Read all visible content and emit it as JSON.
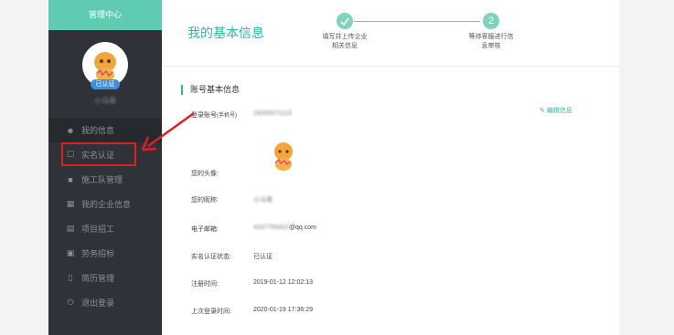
{
  "sidebar": {
    "title": "管理中心",
    "badge": "已认证",
    "username": "小马哥",
    "items": [
      {
        "label": "我的信息",
        "icon": "user-icon"
      },
      {
        "label": "实名认证",
        "icon": "bookmark-icon"
      },
      {
        "label": "施工队管理",
        "icon": "team-icon"
      },
      {
        "label": "我的企业信息",
        "icon": "building-icon"
      },
      {
        "label": "项目招工",
        "icon": "document-icon"
      },
      {
        "label": "劳务招标",
        "icon": "wallet-icon"
      },
      {
        "label": "简历管理",
        "icon": "resume-icon"
      },
      {
        "label": "退出登录",
        "icon": "power-icon"
      }
    ]
  },
  "header": {
    "title": "我的基本信息",
    "steps": [
      {
        "number": "",
        "text1": "填写并上传企业",
        "text2": "相关信息"
      },
      {
        "number": "2",
        "text1": "等待客服进行信",
        "text2": "息审核"
      }
    ]
  },
  "section": {
    "title": "账号基本信息",
    "edit_label": "编辑信息",
    "edit_icon": "edit-icon"
  },
  "fields": {
    "account": {
      "label": "登录账号",
      "sub": "(手机号)",
      "value": "18200071113"
    },
    "avatar": {
      "label": "您的头像:"
    },
    "nickname": {
      "label": "您的昵称:",
      "value": "小马哥"
    },
    "email": {
      "label": "电子邮箱:",
      "value_hidden": "4107755422",
      "value_suffix": "@qq.com"
    },
    "status": {
      "label": "实名认证状态:",
      "value": "已认证"
    },
    "registered": {
      "label": "注册时间:",
      "value": "2019-01-12 12:02:13"
    },
    "last_login": {
      "label": "上次登录时间:",
      "value": "2020-01-19 17:36:29"
    }
  },
  "colors": {
    "accent": "#2cb89d",
    "sidebar": "#2f3238",
    "highlight": "#e02020"
  }
}
